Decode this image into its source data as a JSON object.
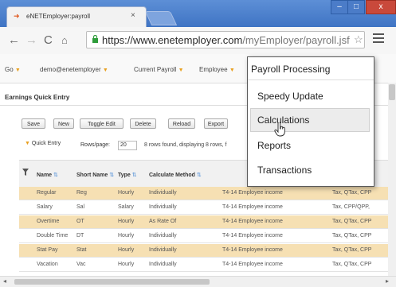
{
  "browser": {
    "tab_title": "eNETEmployer:payroll",
    "tab_close": "×",
    "url_host": "https://www.enetemployer.com",
    "url_path": "/myEmployer/payroll.jsf",
    "window_buttons": [
      "–",
      "□",
      "x"
    ]
  },
  "nav": {
    "go": "Go",
    "user": "demo@enetemployer",
    "current_payroll": "Current Payroll",
    "employee": "Employee"
  },
  "section": {
    "title": "Earnings Quick Entry"
  },
  "toolbar": {
    "buttons": [
      "Save",
      "New",
      "Toggle Edit",
      "Delete",
      "Reload",
      "Export"
    ]
  },
  "quick_entry": {
    "label": "Quick Entry",
    "rows_label": "Rows/page:",
    "rows_value": "20",
    "rows_found": "8 rows found, displaying 8 rows, f"
  },
  "table": {
    "headers": [
      "Name",
      "Short Name",
      "Type",
      "Calculate Method"
    ],
    "rows": [
      {
        "name": "Regular",
        "short": "Reg",
        "type": "Hourly",
        "method": "Individually",
        "tax_class": "T4-14 Employee income",
        "taxes": "Tax, QTax, CPP",
        "hl": true
      },
      {
        "name": "Salary",
        "short": "Sal",
        "type": "Salary",
        "method": "Individually",
        "tax_class": "T4-14 Employee income",
        "taxes": "Tax, CPP/QPP,",
        "hl": false
      },
      {
        "name": "Overtime",
        "short": "OT",
        "type": "Hourly",
        "method": "As Rate Of",
        "tax_class": "T4-14 Employee income",
        "taxes": "Tax, QTax, CPP",
        "hl": true
      },
      {
        "name": "Double Time",
        "short": "DT",
        "type": "Hourly",
        "method": "Individually",
        "tax_class": "T4-14 Employee income",
        "taxes": "Tax, QTax, CPP",
        "hl": false
      },
      {
        "name": "Stat Pay",
        "short": "Stat",
        "type": "Hourly",
        "method": "Individually",
        "tax_class": "T4-14 Employee income",
        "taxes": "Tax, QTax, CPP",
        "hl": true
      },
      {
        "name": "Vacation",
        "short": "Vac",
        "type": "Hourly",
        "method": "Individually",
        "tax_class": "T4-14 Employee income",
        "taxes": "Tax, QTax, CPP",
        "hl": false
      }
    ]
  },
  "dropdown": {
    "header": "Payroll Processing",
    "items": [
      "Speedy Update",
      "Calculations",
      "Reports",
      "Transactions"
    ],
    "hover_index": 1
  },
  "colors": {
    "accent_caret": "#e8a020",
    "row_highlight": "#f6e0b3",
    "chrome_blue": "#3f74c4"
  }
}
